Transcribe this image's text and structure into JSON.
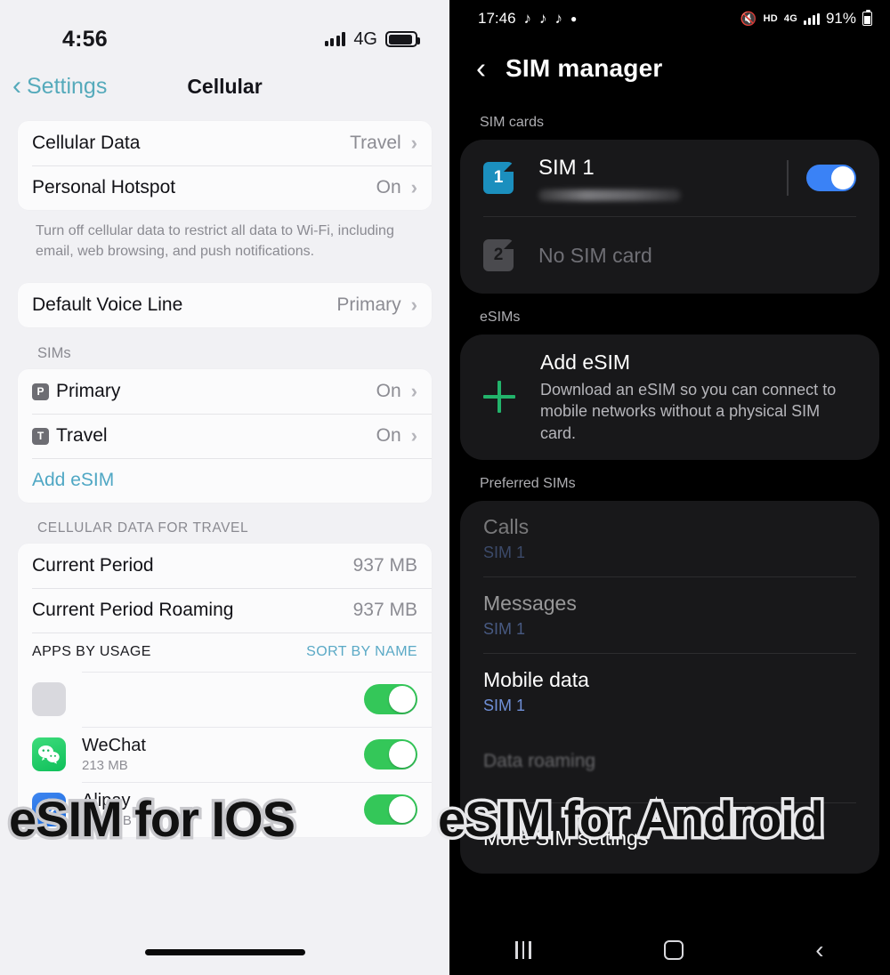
{
  "ios": {
    "status": {
      "time": "4:56",
      "network": "4G",
      "signal_bars": 4,
      "battery_level": 80
    },
    "nav": {
      "back_label": "Settings",
      "title": "Cellular"
    },
    "data_section": {
      "rows": [
        {
          "label": "Cellular Data",
          "value": "Travel"
        },
        {
          "label": "Personal Hotspot",
          "value": "On"
        }
      ],
      "footnote": "Turn off cellular data to restrict all data to Wi-Fi, including email, web browsing, and push notifications."
    },
    "voice_section": {
      "rows": [
        {
          "label": "Default Voice Line",
          "value": "Primary"
        }
      ]
    },
    "sims_section": {
      "header": "SIMs",
      "rows": [
        {
          "badge": "P",
          "label": "Primary",
          "value": "On"
        },
        {
          "badge": "T",
          "label": "Travel",
          "value": "On"
        }
      ],
      "add_esim_label": "Add eSIM"
    },
    "usage_section": {
      "header": "CELLULAR DATA FOR TRAVEL",
      "rows": [
        {
          "label": "Current Period",
          "value": "937 MB"
        },
        {
          "label": "Current Period Roaming",
          "value": "937 MB"
        }
      ],
      "apps_header_left": "APPS BY USAGE",
      "apps_header_right": "SORT BY NAME",
      "apps": [
        {
          "name": "WeChat",
          "size": "213 MB",
          "icon": "wechat-icon",
          "enabled": true
        },
        {
          "name": "Alipay",
          "size": "5.13 MB",
          "icon": "alipay-icon",
          "enabled": true
        }
      ]
    }
  },
  "android": {
    "status": {
      "time": "17:46",
      "app_icons": [
        "tiktok-icon",
        "tiktok-icon",
        "tiktok-icon",
        "dot-icon"
      ],
      "mute": "mute-icon",
      "hd": "HD",
      "network": "4G",
      "battery_percent": "91%"
    },
    "nav": {
      "title": "SIM manager"
    },
    "sim_cards": {
      "header": "SIM cards",
      "rows": [
        {
          "badge": "1",
          "name": "SIM 1",
          "subtitle_obscured": true,
          "enabled": true
        },
        {
          "badge": "2",
          "name": "No SIM card",
          "enabled": false
        }
      ]
    },
    "esims": {
      "header": "eSIMs",
      "title": "Add eSIM",
      "description": "Download an eSIM so you can connect to mobile networks without a physical SIM card."
    },
    "preferred": {
      "header": "Preferred SIMs",
      "rows": [
        {
          "title": "Calls",
          "value": "SIM 1"
        },
        {
          "title": "Messages",
          "value": "SIM 1"
        },
        {
          "title": "Mobile data",
          "value": "SIM 1"
        }
      ],
      "obscured_row": "Data roaming"
    },
    "more_settings_label": "More SIM settings",
    "navbar": {
      "recents": "recents-icon",
      "home": "home-icon",
      "back": "back-icon"
    }
  },
  "overlay": {
    "left_caption": "eSIM for IOS",
    "right_caption": "eSIM for Android"
  },
  "colors": {
    "ios_toggle_on": "#34c759",
    "ios_accent": "#4fa7c4",
    "android_toggle_on": "#3a82f6",
    "android_accent": "#6f8fd6",
    "android_plus": "#22b36b",
    "sim1_badge": "#1b8fbe"
  }
}
